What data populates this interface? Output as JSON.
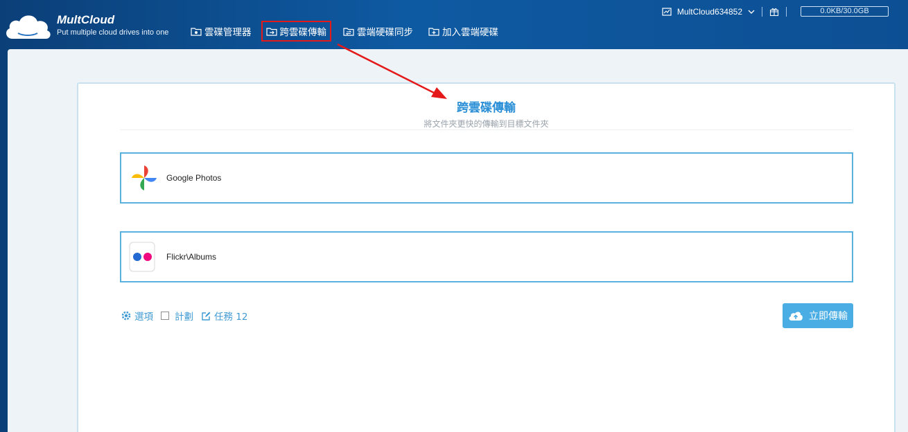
{
  "brand": {
    "name": "MultCloud",
    "tagline": "Put multiple cloud drives into one"
  },
  "nav": {
    "items": [
      {
        "label": "雲碟管理器",
        "icon": "folder-gear-icon"
      },
      {
        "label": "跨雲碟傳輸",
        "icon": "folder-transfer-icon",
        "active": true
      },
      {
        "label": "雲端硬碟同步",
        "icon": "folder-sync-icon"
      },
      {
        "label": "加入雲端硬碟",
        "icon": "folder-add-icon"
      }
    ]
  },
  "account": {
    "username": "MultCloud634852",
    "quota": "0.0KB/30.0GB"
  },
  "transfer": {
    "title": "跨雲碟傳輸",
    "subtitle": "將文件夾更快的傳輸到目標文件夾",
    "source": {
      "label": "Google Photos",
      "icon": "google-photos-icon"
    },
    "destination": {
      "label": "Flickr\\Albums",
      "icon": "flickr-icon"
    },
    "options": {
      "options_label": "選項",
      "schedule_label": "計劃",
      "tasks_label": "任務 12"
    },
    "submit_label": "立即傳輸"
  },
  "colors": {
    "accent": "#2a8fd6",
    "border": "#5ab1de",
    "button": "#4aade3",
    "annotation": "#e41a1a"
  }
}
